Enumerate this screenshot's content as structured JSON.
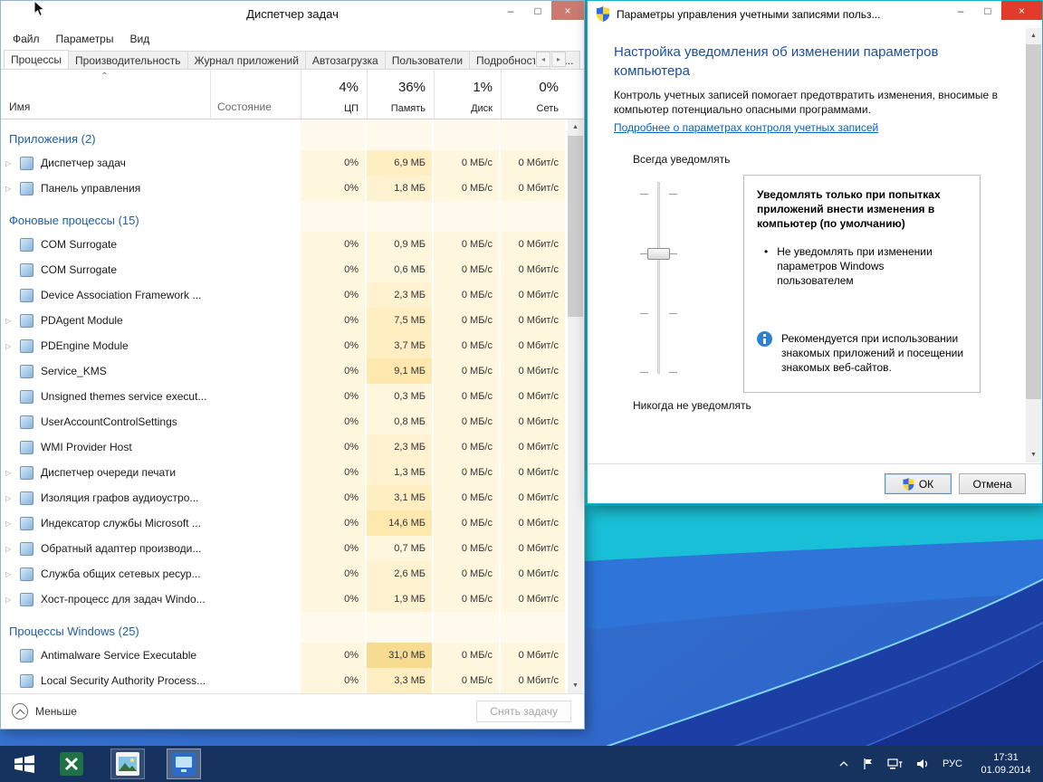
{
  "colors": {
    "accent_teal": "#12B3C4",
    "group_text": "#1D5FA9",
    "link_blue": "#0563C1",
    "heading_blue": "#1C4FA1",
    "taskbar_bg": "#16335F",
    "uac_close_red": "#E23B2E",
    "heat_scale": [
      "#FFFAEB",
      "#FFF6DE",
      "#FFF2D0",
      "#FFEEC2",
      "#FFE8AE",
      "#F7DB90"
    ]
  },
  "glyphs": {
    "minimize": "–",
    "maximize": "□",
    "close": "×",
    "sort_caret": "ˆ",
    "expander": "▷",
    "bullet": "•",
    "scroll_up": "▲",
    "scroll_down": "▼",
    "tab_prev": "◂",
    "tab_next": "▸"
  },
  "task_manager": {
    "title": "Диспетчер задач",
    "menu": [
      "Файл",
      "Параметры",
      "Вид"
    ],
    "tabs": [
      {
        "label": "Процессы",
        "selected": true
      },
      {
        "label": "Производительность",
        "selected": false
      },
      {
        "label": "Журнал приложений",
        "selected": false
      },
      {
        "label": "Автозагрузка",
        "selected": false
      },
      {
        "label": "Пользователи",
        "selected": false
      },
      {
        "label": "Подробности",
        "selected": false
      },
      {
        "label": "С...",
        "selected": false
      }
    ],
    "header": {
      "name": "Имя",
      "status": "Состояние",
      "cpu": {
        "pct": "4%",
        "label": "ЦП"
      },
      "memory": {
        "pct": "36%",
        "label": "Память"
      },
      "disk": {
        "pct": "1%",
        "label": "Диск"
      },
      "network": {
        "pct": "0%",
        "label": "Сеть"
      }
    },
    "groups": [
      {
        "label": "Приложения (2)",
        "rows": [
          {
            "name": "Диспетчер задач",
            "expand": true,
            "cpu": "0%",
            "memory": "6,9 МБ",
            "disk": "0 МБ/с",
            "network": "0 Мбит/с"
          },
          {
            "name": "Панель управления",
            "expand": true,
            "cpu": "0%",
            "memory": "1,8 МБ",
            "disk": "0 МБ/с",
            "network": "0 Мбит/с"
          }
        ]
      },
      {
        "label": "Фоновые процессы (15)",
        "rows": [
          {
            "name": "COM Surrogate",
            "expand": false,
            "cpu": "0%",
            "memory": "0,9 МБ",
            "disk": "0 МБ/с",
            "network": "0 Мбит/с"
          },
          {
            "name": "COM Surrogate",
            "expand": false,
            "cpu": "0%",
            "memory": "0,6 МБ",
            "disk": "0 МБ/с",
            "network": "0 Мбит/с"
          },
          {
            "name": "Device Association Framework ...",
            "expand": false,
            "cpu": "0%",
            "memory": "2,3 МБ",
            "disk": "0 МБ/с",
            "network": "0 Мбит/с"
          },
          {
            "name": "PDAgent Module",
            "expand": true,
            "cpu": "0%",
            "memory": "7,5 МБ",
            "disk": "0 МБ/с",
            "network": "0 Мбит/с"
          },
          {
            "name": "PDEngine Module",
            "expand": true,
            "cpu": "0%",
            "memory": "3,7 МБ",
            "disk": "0 МБ/с",
            "network": "0 Мбит/с"
          },
          {
            "name": "Service_KMS",
            "expand": false,
            "cpu": "0%",
            "memory": "9,1 МБ",
            "disk": "0 МБ/с",
            "network": "0 Мбит/с"
          },
          {
            "name": "Unsigned themes service execut...",
            "expand": false,
            "cpu": "0%",
            "memory": "0,3 МБ",
            "disk": "0 МБ/с",
            "network": "0 Мбит/с"
          },
          {
            "name": "UserAccountControlSettings",
            "expand": false,
            "cpu": "0%",
            "memory": "0,8 МБ",
            "disk": "0 МБ/с",
            "network": "0 Мбит/с"
          },
          {
            "name": "WMI Provider Host",
            "expand": false,
            "cpu": "0%",
            "memory": "2,3 МБ",
            "disk": "0 МБ/с",
            "network": "0 Мбит/с"
          },
          {
            "name": "Диспетчер очереди печати",
            "expand": true,
            "cpu": "0%",
            "memory": "1,3 МБ",
            "disk": "0 МБ/с",
            "network": "0 Мбит/с"
          },
          {
            "name": "Изоляция графов аудиоустро...",
            "expand": true,
            "cpu": "0%",
            "memory": "3,1 МБ",
            "disk": "0 МБ/с",
            "network": "0 Мбит/с"
          },
          {
            "name": "Индексатор службы Microsoft ...",
            "expand": true,
            "cpu": "0%",
            "memory": "14,6 МБ",
            "disk": "0 МБ/с",
            "network": "0 Мбит/с"
          },
          {
            "name": "Обратный адаптер производи...",
            "expand": true,
            "cpu": "0%",
            "memory": "0,7 МБ",
            "disk": "0 МБ/с",
            "network": "0 Мбит/с"
          },
          {
            "name": "Служба общих сетевых ресур...",
            "expand": true,
            "cpu": "0%",
            "memory": "2,6 МБ",
            "disk": "0 МБ/с",
            "network": "0 Мбит/с"
          },
          {
            "name": "Хост-процесс для задач Windo...",
            "expand": true,
            "cpu": "0%",
            "memory": "1,9 МБ",
            "disk": "0 МБ/с",
            "network": "0 Мбит/с"
          }
        ]
      },
      {
        "label": "Процессы Windows (25)",
        "rows": [
          {
            "name": "Antimalware Service Executable",
            "expand": false,
            "cpu": "0%",
            "memory": "31,0 МБ",
            "disk": "0 МБ/с",
            "network": "0 Мбит/с"
          },
          {
            "name": "Local Security Authority Process...",
            "expand": false,
            "cpu": "0%",
            "memory": "3,3 МБ",
            "disk": "0 МБ/с",
            "network": "0 Мбит/с"
          }
        ]
      }
    ],
    "footer": {
      "details_toggle": "Меньше",
      "end_task": "Снять задачу"
    }
  },
  "uac": {
    "title": "Параметры управления учетными записями польз...",
    "heading": "Настройка уведомления об изменении параметров компьютера",
    "description": "Контроль учетных записей помогает предотвратить изменения, вносимые в компьютер потенциально опасными программами.",
    "link": "Подробнее о параметрах контроля учетных записей",
    "slider_top_label": "Всегда уведомлять",
    "slider_bottom_label": "Никогда не уведомлять",
    "notify_title": "Уведомлять только при попытках приложений внести изменения в компьютер (по умолчанию)",
    "notify_bullet": "Не уведомлять при изменении параметров Windows пользователем",
    "recommendation": "Рекомендуется при использовании знакомых приложений и посещении знакомых веб-сайтов.",
    "ok_label": "ОК",
    "cancel_label": "Отмена"
  },
  "taskbar": {
    "language": "РУС",
    "time": "17:31",
    "date": "01.09.2014"
  }
}
